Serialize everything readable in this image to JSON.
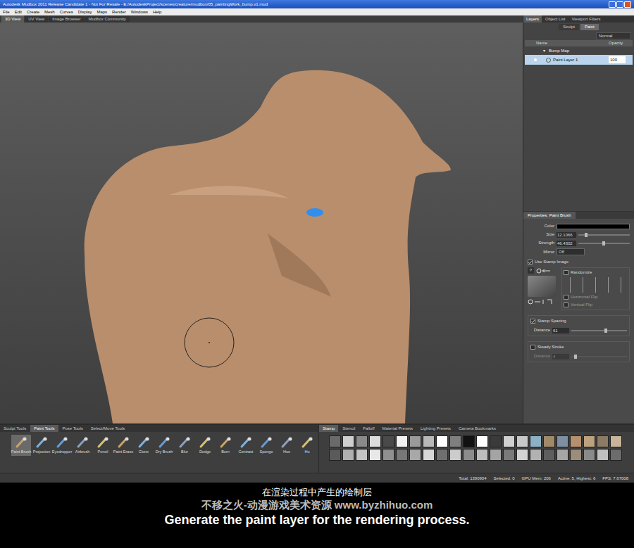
{
  "window": {
    "title": "Autodesk Mudbox 2011 Release Candidate 1 - Not For Resale - E:/AutodeskProject/scenes/creature/mudbox/05_paintingWork_bump.v1.mud"
  },
  "menu": [
    "File",
    "Edit",
    "Create",
    "Mesh",
    "Curves",
    "Display",
    "Maps",
    "Render",
    "Windows",
    "Help"
  ],
  "view_tabs": [
    {
      "label": "3D View",
      "selected": true
    },
    {
      "label": "UV View",
      "selected": false
    },
    {
      "label": "Image Browser",
      "selected": false
    },
    {
      "label": "Mudbox Community",
      "selected": false
    }
  ],
  "layers_panel": {
    "tabs": [
      {
        "label": "Layers",
        "selected": true
      },
      {
        "label": "Object List",
        "selected": false
      },
      {
        "label": "Viewport Filters",
        "selected": false
      }
    ],
    "mode_tabs": [
      {
        "label": "Sculpt",
        "selected": false
      },
      {
        "label": "Paint",
        "selected": true
      }
    ],
    "blend_mode": "Normal",
    "columns": [
      "Name",
      "Opacity"
    ],
    "groups": [
      {
        "name": "Bump Map",
        "expanded": true,
        "expander": "▾",
        "layers": [
          {
            "name": "Paint Layer 1",
            "opacity": "100",
            "selected": true,
            "visible": true
          }
        ]
      }
    ]
  },
  "properties": {
    "title": "Properties: Paint Brush",
    "color": {
      "label": "Color",
      "value": "#000000"
    },
    "fields": [
      {
        "label": "Size",
        "value": "12.1066",
        "level": 0.12
      },
      {
        "label": "Strength",
        "value": "46.4302",
        "level": 0.46
      }
    ],
    "mirror": {
      "label": "Mirror",
      "value": "Off"
    },
    "use_stamp_image": {
      "label": "Use Stamp Image",
      "checked": true
    },
    "stamp_help": "?",
    "randomize": {
      "label": "Randomize",
      "checked": false
    },
    "flips": [
      {
        "label": "Horizontal Flip",
        "checked": false
      },
      {
        "label": "Vertical Flip",
        "checked": false
      }
    ],
    "stamp_spacing": {
      "label": "Stamp Spacing",
      "checked": true,
      "distance_label": "Distance",
      "distance": "61",
      "level": 0.6
    },
    "steady_stroke": {
      "label": "Steady Stroke",
      "checked": false,
      "distance_label": "Distance",
      "distance": "4",
      "disabled": true,
      "level": 0.05
    }
  },
  "tray": {
    "tool_tabs": [
      {
        "label": "Sculpt Tools",
        "selected": false
      },
      {
        "label": "Paint Tools",
        "selected": true
      },
      {
        "label": "Pose Tools",
        "selected": false
      },
      {
        "label": "Select/Move Tools",
        "selected": false
      }
    ],
    "tools": [
      {
        "label": "Paint Brush",
        "selected": true
      },
      {
        "label": "Projection",
        "selected": false
      },
      {
        "label": "Eyedropper",
        "selected": false
      },
      {
        "label": "Airbrush",
        "selected": false
      },
      {
        "label": "Pencil",
        "selected": false
      },
      {
        "label": "Paint Erase",
        "selected": false
      },
      {
        "label": "Clone",
        "selected": false
      },
      {
        "label": "Dry Brush",
        "selected": false
      },
      {
        "label": "Blur",
        "selected": false
      },
      {
        "label": "Dodge",
        "selected": false
      },
      {
        "label": "Burn",
        "selected": false
      },
      {
        "label": "Contrast",
        "selected": false
      },
      {
        "label": "Sponge",
        "selected": false
      },
      {
        "label": "Hue",
        "selected": false
      },
      {
        "label": "Hu",
        "selected": false
      }
    ],
    "stamp_tabs": [
      {
        "label": "Stamp",
        "selected": true
      },
      {
        "label": "Stencil",
        "selected": false
      },
      {
        "label": "Falloff",
        "selected": false
      },
      {
        "label": "Material Presets",
        "selected": false
      },
      {
        "label": "Lighting Presets",
        "selected": false
      },
      {
        "label": "Camera Bookmarks",
        "selected": false
      }
    ],
    "stamps": [
      "#6a6a6a",
      "#cfcfcf",
      "#8a8a8a",
      "#dcdcdc",
      "#4a4a4a",
      "#f2f2f2",
      "#9a9a9a",
      "#b8b8b8",
      "#ffffff",
      "#7f7f7f",
      "#111111",
      "#ffffff",
      "#3a3a3a",
      "#d0d0d0",
      "#c9c9c9",
      "#8eb0c4",
      "#a08a6a",
      "#7d8fa0",
      "#b59070",
      "#bca27e",
      "#8a7a66",
      "#c8b49a",
      "#5a5a5a",
      "#b0b0b0",
      "#c4c4c4",
      "#e8e8e8",
      "#909090",
      "#777777",
      "#a8a8a8",
      "#d8d8d8",
      "#6f6f6f",
      "#cccccc",
      "#8c8c8c",
      "#bdbdbd",
      "#a4a4a4",
      "#7a7a7a",
      "#d4d4d4",
      "#b2b2b2",
      "#5e5e5e",
      "#a6a6a6",
      "#9b8d7a",
      "#8a8a8a",
      "#c0c0c0",
      "#6c6c6c"
    ]
  },
  "status_bar": {
    "items": [
      "Total: 1390904",
      "Selected: 0",
      "GPU Mem: 206",
      "Active: 5, Highest: 6",
      "FPS: 7.67008"
    ]
  },
  "subtitles": {
    "zh": "在渲染过程中产生的绘制层",
    "en": "Generate the paint layer for the rendering process."
  },
  "watermark": "不移之火-动漫游戏美术资源 www.byzhihuo.com"
}
